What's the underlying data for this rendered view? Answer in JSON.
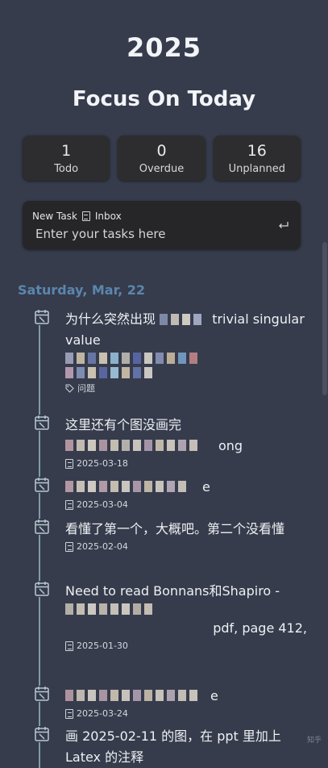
{
  "header": {
    "year": "2025",
    "title": "Focus On Today"
  },
  "stats": [
    {
      "value": "1",
      "label": "Todo"
    },
    {
      "value": "0",
      "label": "Overdue"
    },
    {
      "value": "16",
      "label": "Unplanned"
    }
  ],
  "new_task": {
    "label": "New Task",
    "list_name": "Inbox",
    "placeholder": "Enter your tasks here"
  },
  "date_heading": "Saturday, Mar, 22",
  "tasks": [
    {
      "title": "为什么突然出现",
      "title_tail": "trivial singular value",
      "meta": "",
      "tag": "问题"
    },
    {
      "title": "这里还有个图没画完",
      "title_tail": "ong",
      "meta": "2025-03-18",
      "tag": ""
    },
    {
      "title": "",
      "title_tail": "e",
      "meta": "2025-03-04",
      "tag": ""
    },
    {
      "title": "看懂了第一个，大概吧。第二个没看懂",
      "title_tail": "",
      "meta": "2025-02-04",
      "tag": ""
    },
    {
      "title": "Need to read Bonnans和Shapiro -",
      "title_tail": "pdf, page 412,",
      "meta": "2025-01-30",
      "tag": ""
    },
    {
      "title": "",
      "title_tail": "e",
      "meta": "2025-03-24",
      "tag": ""
    },
    {
      "title": "画 2025-02-11 的图，在 ppt 里加上 Latex 的注释",
      "title_tail": "",
      "meta": "",
      "tag": ""
    }
  ],
  "watermark": "知乎"
}
